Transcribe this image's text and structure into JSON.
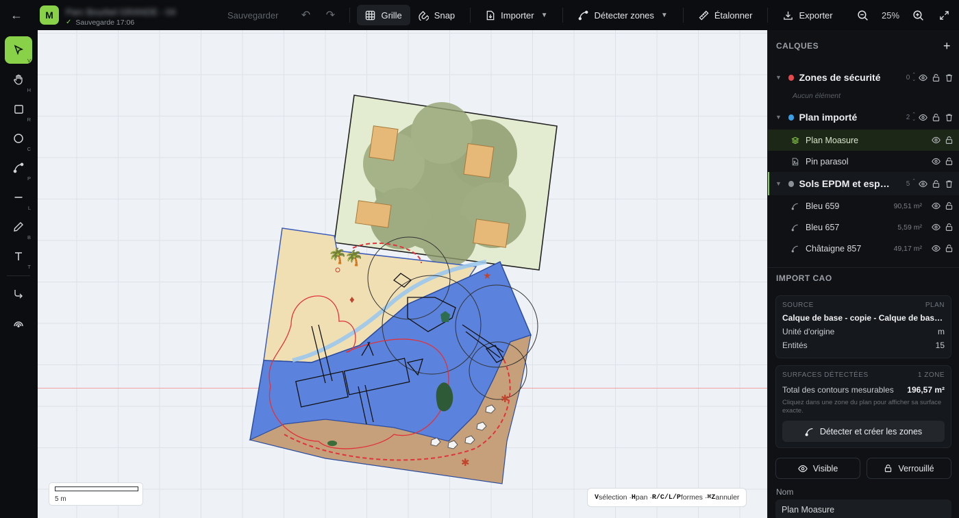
{
  "topbar": {
    "logo": "M",
    "project_name": "Parc Bourbel GRANDE - 04",
    "save_status": "Sauvegarde 17:06",
    "save_label": "Sauvegarder",
    "grid_label": "Grille",
    "snap_label": "Snap",
    "import_label": "Importer",
    "detect_label": "Détecter zones",
    "calibrate_label": "Étalonner",
    "export_label": "Exporter",
    "zoom": "25%"
  },
  "tools": [
    {
      "name": "select",
      "key": "V"
    },
    {
      "name": "hand",
      "key": "H"
    },
    {
      "name": "rect",
      "key": "R"
    },
    {
      "name": "circle",
      "key": "C"
    },
    {
      "name": "path",
      "key": "P"
    },
    {
      "name": "line",
      "key": "L"
    },
    {
      "name": "pencil",
      "key": "B"
    },
    {
      "name": "text",
      "key": "T"
    }
  ],
  "canvas": {
    "scale_label": "5 m",
    "hints": {
      "k1": "V",
      "t1": " sélection · ",
      "k2": "H",
      "t2": " pan · ",
      "k3": "R/C/L/P",
      "t3": " formes · ",
      "k4": "⌘Z",
      "t4": " annuler"
    }
  },
  "layers_panel": {
    "title": "CALQUES",
    "groups": [
      {
        "name": "Zones de sécurité",
        "color": "#e5484d",
        "count": "0",
        "empty_text": "Aucun élément"
      },
      {
        "name": "Plan importé",
        "color": "#3b9ee8",
        "count": "2",
        "items": [
          {
            "name": "Plan Moasure"
          },
          {
            "name": "Pin parasol"
          }
        ]
      },
      {
        "name": "Sols EPDM et espaces verts",
        "color": "#8a9096",
        "count": "5",
        "items": [
          {
            "name": "Bleu 659",
            "area": "90,51 m²"
          },
          {
            "name": "Bleu 657",
            "area": "5,59 m²"
          },
          {
            "name": "Châtaigne 857",
            "area": "49,17 m²"
          }
        ]
      }
    ]
  },
  "import_cao": {
    "title": "IMPORT CAO",
    "source_caption": "SOURCE",
    "source_kind": "PLAN",
    "source_name": "Calque de base - copie - Calque de base - Plan Moasure",
    "unit_label": "Unité d'origine",
    "unit_value": "m",
    "entities_label": "Entités",
    "entities_value": "15"
  },
  "surfaces": {
    "caption": "SURFACES DÉTECTÉES",
    "zone_count": "1 ZONE",
    "total_label": "Total des contours mesurables",
    "total_value": "196,57 m²",
    "note": "Cliquez dans une zone du plan pour afficher sa surface exacte.",
    "detect_button": "Détecter et créer les zones"
  },
  "layer_props": {
    "visible_label": "Visible",
    "locked_label": "Verrouillé",
    "name_label": "Nom",
    "name_value": "Plan Moasure"
  }
}
